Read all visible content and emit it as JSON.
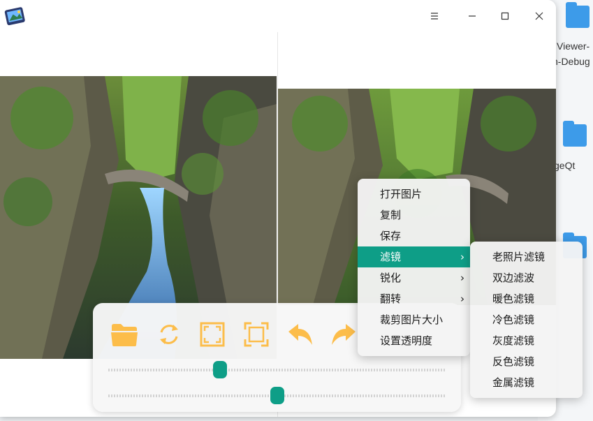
{
  "desktop": {
    "items": [
      {
        "label_line1": "Viewer-",
        "label_line2": "n-Debug"
      },
      {
        "label_line1": "geQt"
      }
    ]
  },
  "window": {
    "menu_icon": "hamburger-menu-icon",
    "minimize_icon": "minimize-icon",
    "maximize_icon": "maximize-icon",
    "close_icon": "close-icon"
  },
  "toolbar": {
    "tools": [
      {
        "name": "open-folder-button",
        "icon": "folder-icon"
      },
      {
        "name": "rotate-button",
        "icon": "rotate-icon"
      },
      {
        "name": "fit-window-button",
        "icon": "fit-frame-icon"
      },
      {
        "name": "original-size-button",
        "icon": "crop-frame-icon"
      },
      {
        "name": "undo-button",
        "icon": "undo-arrow-icon"
      },
      {
        "name": "redo-button",
        "icon": "redo-arrow-icon"
      }
    ],
    "accent": "#fcbd4a",
    "slider1_value": 0.33,
    "slider2_value": 0.5,
    "slider_color": "#0e9e87"
  },
  "context_menu": {
    "items": [
      "打开图片",
      "复制",
      "保存",
      "滤镜",
      "锐化",
      "翻转",
      "裁剪图片大小",
      "设置透明度"
    ],
    "active": "滤镜",
    "active_color": "#0e9e87"
  },
  "filter_submenu": {
    "items": [
      "老照片滤镜",
      "双边滤波",
      "暖色滤镜",
      "冷色滤镜",
      "灰度滤镜",
      "反色滤镜",
      "金属滤镜"
    ]
  }
}
